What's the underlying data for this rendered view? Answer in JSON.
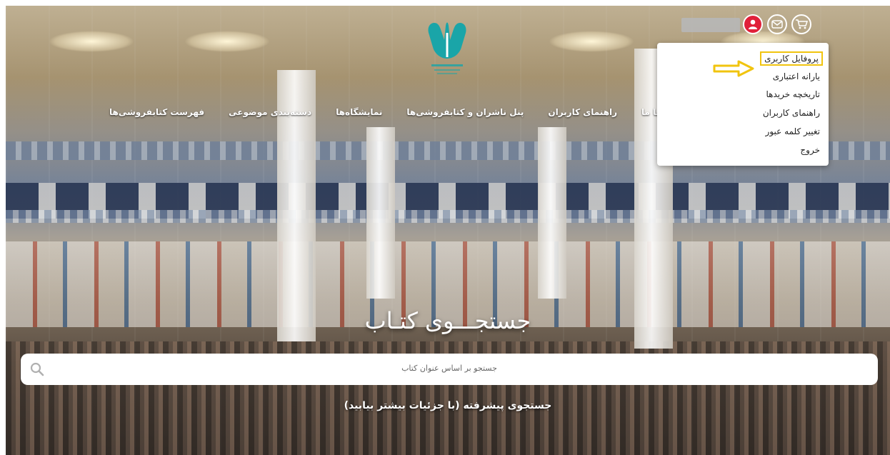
{
  "header": {
    "nav": [
      "فهرست کتابفروشی‌ها",
      "دسته‌بندی موضوعی",
      "نمایشگاه‌ها",
      "پنل ناشران و کتابفروشی‌ها",
      "راهنمای کاربران",
      "تماس با ما"
    ]
  },
  "user_menu": {
    "items": [
      "پروفایل کاربری",
      "یارانه اعتباری",
      "تاریخچه خریدها",
      "راهنمای کاربران",
      "تغییر کلمه عبور",
      "خروج"
    ]
  },
  "hero": {
    "title": "جستجـــوی کتـاب",
    "search_placeholder": "جستجو بر اساس عنوان کتاب",
    "advanced_search": "جستجوی پیشرفته (با جزئیات بیشتر بیابید)"
  },
  "colors": {
    "brand_teal": "#1aa5a8",
    "user_icon_red": "#e0213a",
    "highlight_yellow": "#f1c40f"
  }
}
